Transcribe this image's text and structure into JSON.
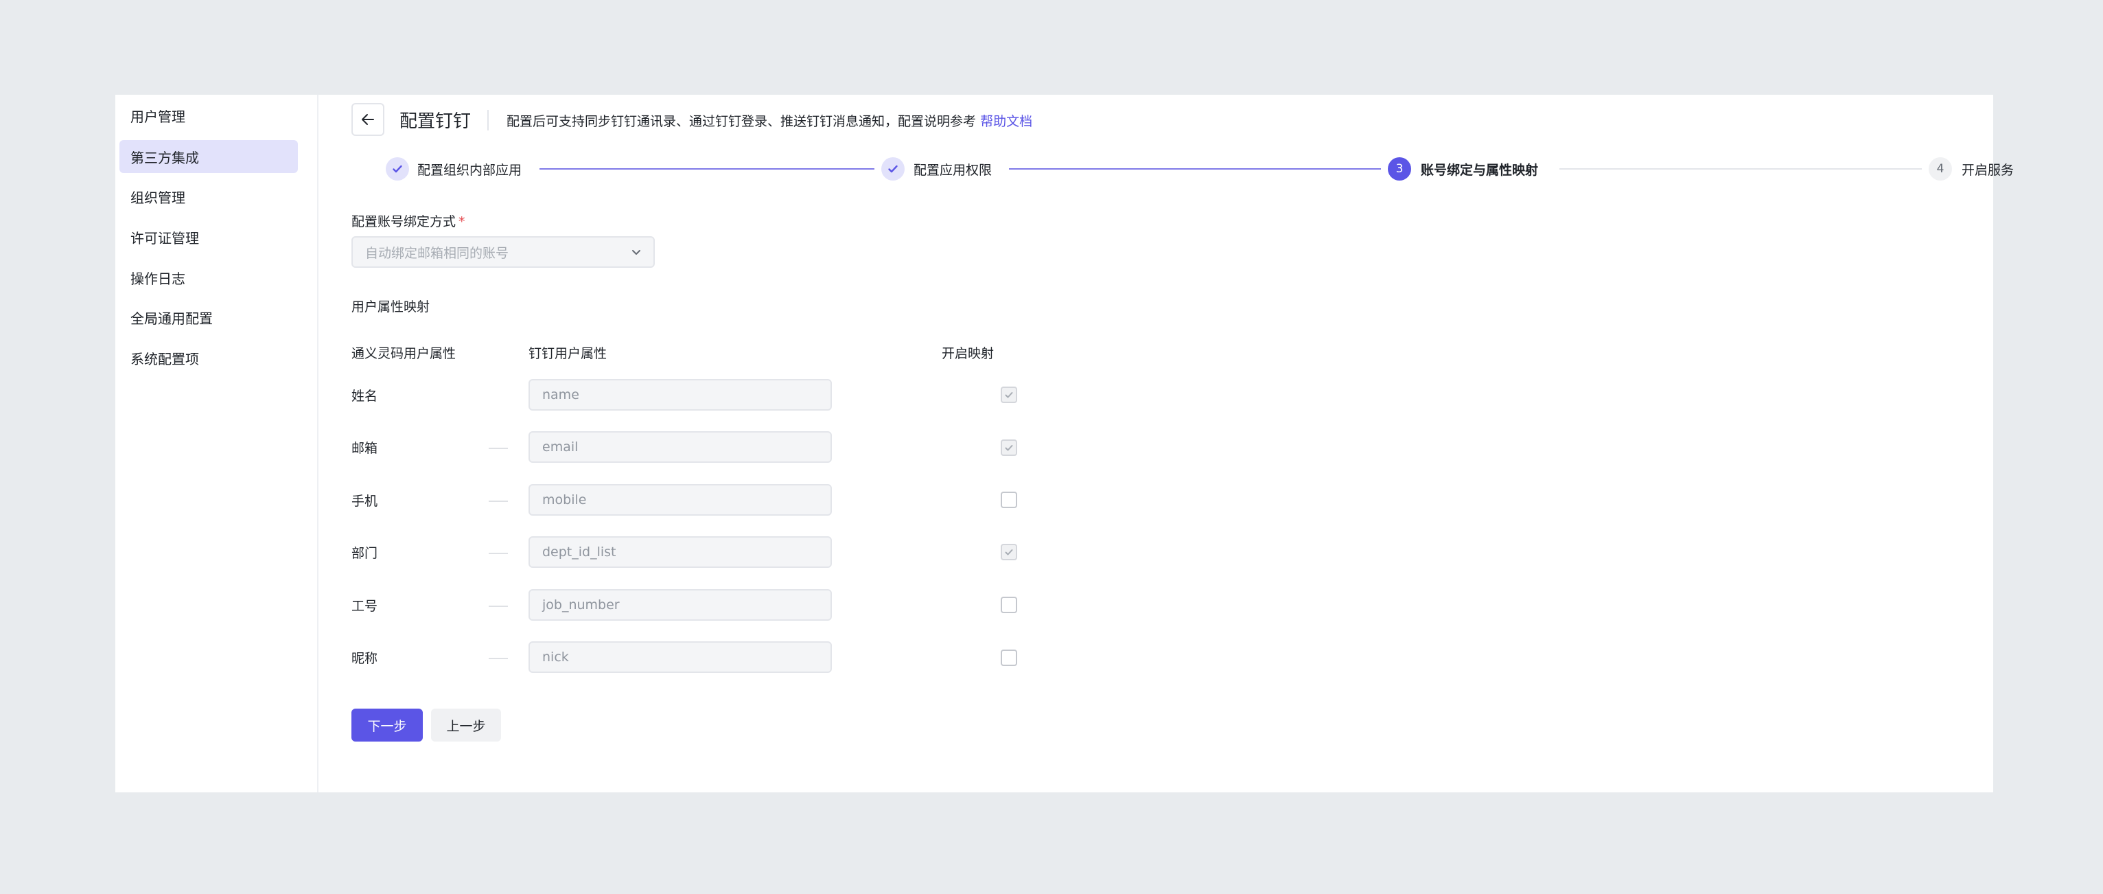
{
  "sidebar": {
    "items": [
      {
        "label": "用户管理",
        "active": false
      },
      {
        "label": "第三方集成",
        "active": true
      },
      {
        "label": "组织管理",
        "active": false
      },
      {
        "label": "许可证管理",
        "active": false
      },
      {
        "label": "操作日志",
        "active": false
      },
      {
        "label": "全局通用配置",
        "active": false
      },
      {
        "label": "系统配置项",
        "active": false
      }
    ]
  },
  "header": {
    "back_icon": "arrow-left-icon",
    "title": "配置钉钉",
    "description": "配置后可支持同步钉钉通讯录、通过钉钉登录、推送钉钉消息通知，配置说明参考",
    "help_link": "帮助文档"
  },
  "steps": [
    {
      "number": "1",
      "label": "配置组织内部应用",
      "status": "done"
    },
    {
      "number": "2",
      "label": "配置应用权限",
      "status": "done"
    },
    {
      "number": "3",
      "label": "账号绑定与属性映射",
      "status": "current"
    },
    {
      "number": "4",
      "label": "开启服务",
      "status": "pending"
    }
  ],
  "binding": {
    "label": "配置账号绑定方式",
    "required_mark": "*",
    "selected": "自动绑定邮箱相同的账号"
  },
  "mapping": {
    "section_title": "用户属性映射",
    "columns": {
      "local": "通义灵码用户属性",
      "dingtalk": "钉钉用户属性",
      "enabled": "开启映射"
    },
    "rows": [
      {
        "label": "姓名",
        "value": "name",
        "checked": true,
        "disabled": true
      },
      {
        "label": "邮箱",
        "value": "email",
        "checked": true,
        "disabled": true
      },
      {
        "label": "手机",
        "value": "mobile",
        "checked": false,
        "disabled": false
      },
      {
        "label": "部门",
        "value": "dept_id_list",
        "checked": true,
        "disabled": true
      },
      {
        "label": "工号",
        "value": "job_number",
        "checked": false,
        "disabled": false
      },
      {
        "label": "昵称",
        "value": "nick",
        "checked": false,
        "disabled": false
      }
    ]
  },
  "actions": {
    "next": "下一步",
    "prev": "上一步"
  },
  "colors": {
    "accent": "#5b55e6",
    "accent_light": "#e2e2fb",
    "page_bg": "#e8ebee"
  }
}
